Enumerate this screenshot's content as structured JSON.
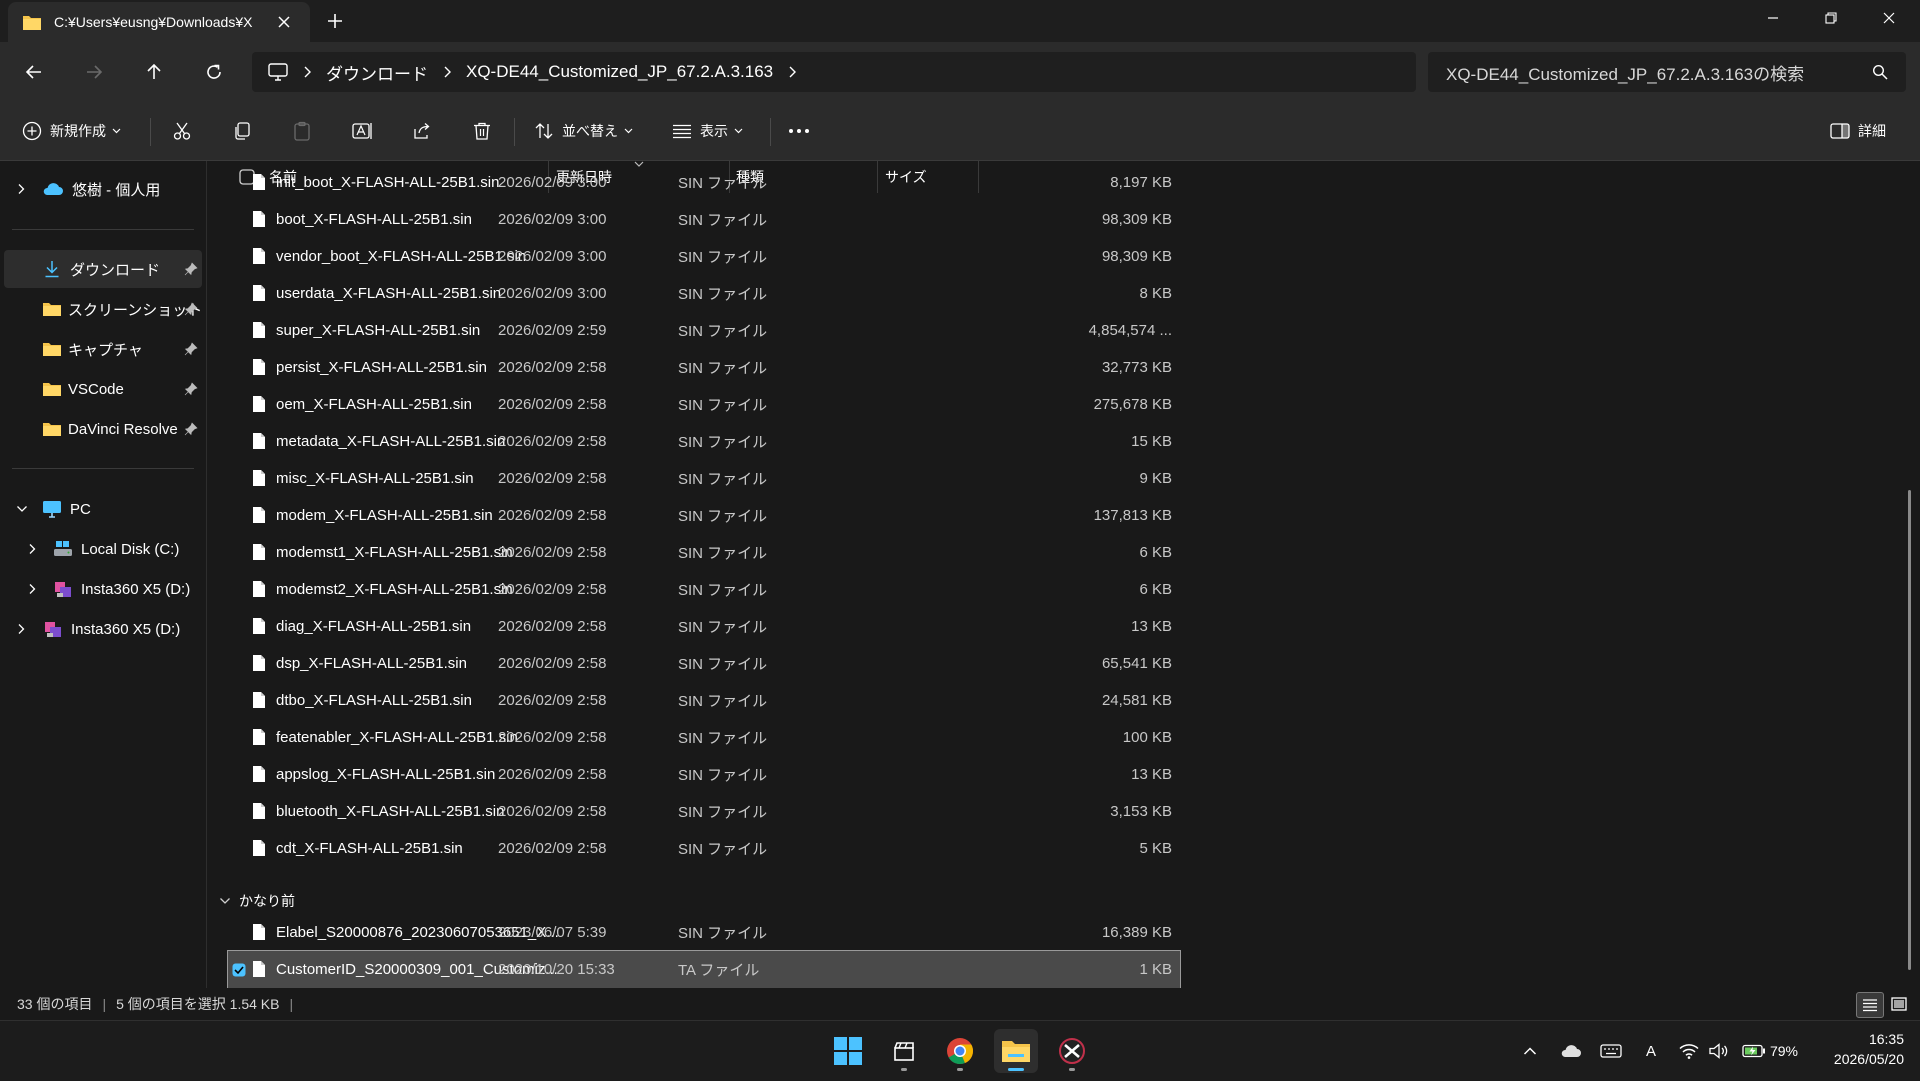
{
  "colors": {
    "accent": "#4cc2ff",
    "folder": "#f5c44a",
    "selection": "#4a4a4a"
  },
  "tab": {
    "title": "C:¥Users¥eusng¥Downloads¥X"
  },
  "address": {
    "segments": [
      "ダウンロード",
      "XQ-DE44_Customized_JP_67.2.A.3.163"
    ]
  },
  "search": {
    "placeholder": "XQ-DE44_Customized_JP_67.2.A.3.163の検索"
  },
  "toolbar": {
    "new_label": "新規作成",
    "sort_label": "並べ替え",
    "view_label": "表示",
    "details_label": "詳細"
  },
  "sidebar": {
    "home_item": "悠樹 - 個人用",
    "quick_access": [
      {
        "label": "ダウンロード",
        "icon": "download-icon"
      },
      {
        "label": "スクリーンショット",
        "icon": "folder-icon"
      },
      {
        "label": "キャプチャ",
        "icon": "folder-icon"
      },
      {
        "label": "VSCode",
        "icon": "folder-icon"
      },
      {
        "label": "DaVinci Resolve",
        "icon": "folder-icon"
      }
    ],
    "pc_label": "PC",
    "drives": [
      {
        "label": "Local Disk (C:)"
      },
      {
        "label": "Insta360 X5 (D:)"
      }
    ],
    "external_drive": "Insta360 X5 (D:)"
  },
  "columns": {
    "name": "名前",
    "date": "更新日時",
    "type": "種類",
    "size": "サイズ"
  },
  "files": [
    {
      "name": "init_boot_X-FLASH-ALL-25B1.sin",
      "date": "2026/02/09 3:00",
      "type": "SIN ファイル",
      "size": "8,197 KB"
    },
    {
      "name": "boot_X-FLASH-ALL-25B1.sin",
      "date": "2026/02/09 3:00",
      "type": "SIN ファイル",
      "size": "98,309 KB"
    },
    {
      "name": "vendor_boot_X-FLASH-ALL-25B1.sin",
      "date": "2026/02/09 3:00",
      "type": "SIN ファイル",
      "size": "98,309 KB"
    },
    {
      "name": "userdata_X-FLASH-ALL-25B1.sin",
      "date": "2026/02/09 3:00",
      "type": "SIN ファイル",
      "size": "8 KB"
    },
    {
      "name": "super_X-FLASH-ALL-25B1.sin",
      "date": "2026/02/09 2:59",
      "type": "SIN ファイル",
      "size": "4,854,574 ..."
    },
    {
      "name": "persist_X-FLASH-ALL-25B1.sin",
      "date": "2026/02/09 2:58",
      "type": "SIN ファイル",
      "size": "32,773 KB"
    },
    {
      "name": "oem_X-FLASH-ALL-25B1.sin",
      "date": "2026/02/09 2:58",
      "type": "SIN ファイル",
      "size": "275,678 KB"
    },
    {
      "name": "metadata_X-FLASH-ALL-25B1.sin",
      "date": "2026/02/09 2:58",
      "type": "SIN ファイル",
      "size": "15 KB"
    },
    {
      "name": "misc_X-FLASH-ALL-25B1.sin",
      "date": "2026/02/09 2:58",
      "type": "SIN ファイル",
      "size": "9 KB"
    },
    {
      "name": "modem_X-FLASH-ALL-25B1.sin",
      "date": "2026/02/09 2:58",
      "type": "SIN ファイル",
      "size": "137,813 KB"
    },
    {
      "name": "modemst1_X-FLASH-ALL-25B1.sin",
      "date": "2026/02/09 2:58",
      "type": "SIN ファイル",
      "size": "6 KB"
    },
    {
      "name": "modemst2_X-FLASH-ALL-25B1.sin",
      "date": "2026/02/09 2:58",
      "type": "SIN ファイル",
      "size": "6 KB"
    },
    {
      "name": "diag_X-FLASH-ALL-25B1.sin",
      "date": "2026/02/09 2:58",
      "type": "SIN ファイル",
      "size": "13 KB"
    },
    {
      "name": "dsp_X-FLASH-ALL-25B1.sin",
      "date": "2026/02/09 2:58",
      "type": "SIN ファイル",
      "size": "65,541 KB"
    },
    {
      "name": "dtbo_X-FLASH-ALL-25B1.sin",
      "date": "2026/02/09 2:58",
      "type": "SIN ファイル",
      "size": "24,581 KB"
    },
    {
      "name": "featenabler_X-FLASH-ALL-25B1.sin",
      "date": "2026/02/09 2:58",
      "type": "SIN ファイル",
      "size": "100 KB"
    },
    {
      "name": "appslog_X-FLASH-ALL-25B1.sin",
      "date": "2026/02/09 2:58",
      "type": "SIN ファイル",
      "size": "13 KB"
    },
    {
      "name": "bluetooth_X-FLASH-ALL-25B1.sin",
      "date": "2026/02/09 2:58",
      "type": "SIN ファイル",
      "size": "3,153 KB"
    },
    {
      "name": "cdt_X-FLASH-ALL-25B1.sin",
      "date": "2026/02/09 2:58",
      "type": "SIN ファイル",
      "size": "5 KB"
    }
  ],
  "group_older": {
    "label": "かなり前",
    "files": [
      {
        "name": "Elabel_S20000876_20230607053651_X...",
        "date": "2023/06/07 5:39",
        "type": "SIN ファイル",
        "size": "16,389 KB",
        "selected": false
      },
      {
        "name": "CustomerID_S20000309_001_Customiz...",
        "date": "2020/10/20 15:33",
        "type": "TA ファイル",
        "size": "1 KB",
        "selected": true
      }
    ]
  },
  "status": {
    "item_count": "33 個の項目",
    "selection": "5 個の項目を選択  1.54 KB"
  },
  "tray": {
    "keyboard_mode": "A",
    "battery": "79%",
    "time": "16:35",
    "date": "2026/05/20"
  }
}
